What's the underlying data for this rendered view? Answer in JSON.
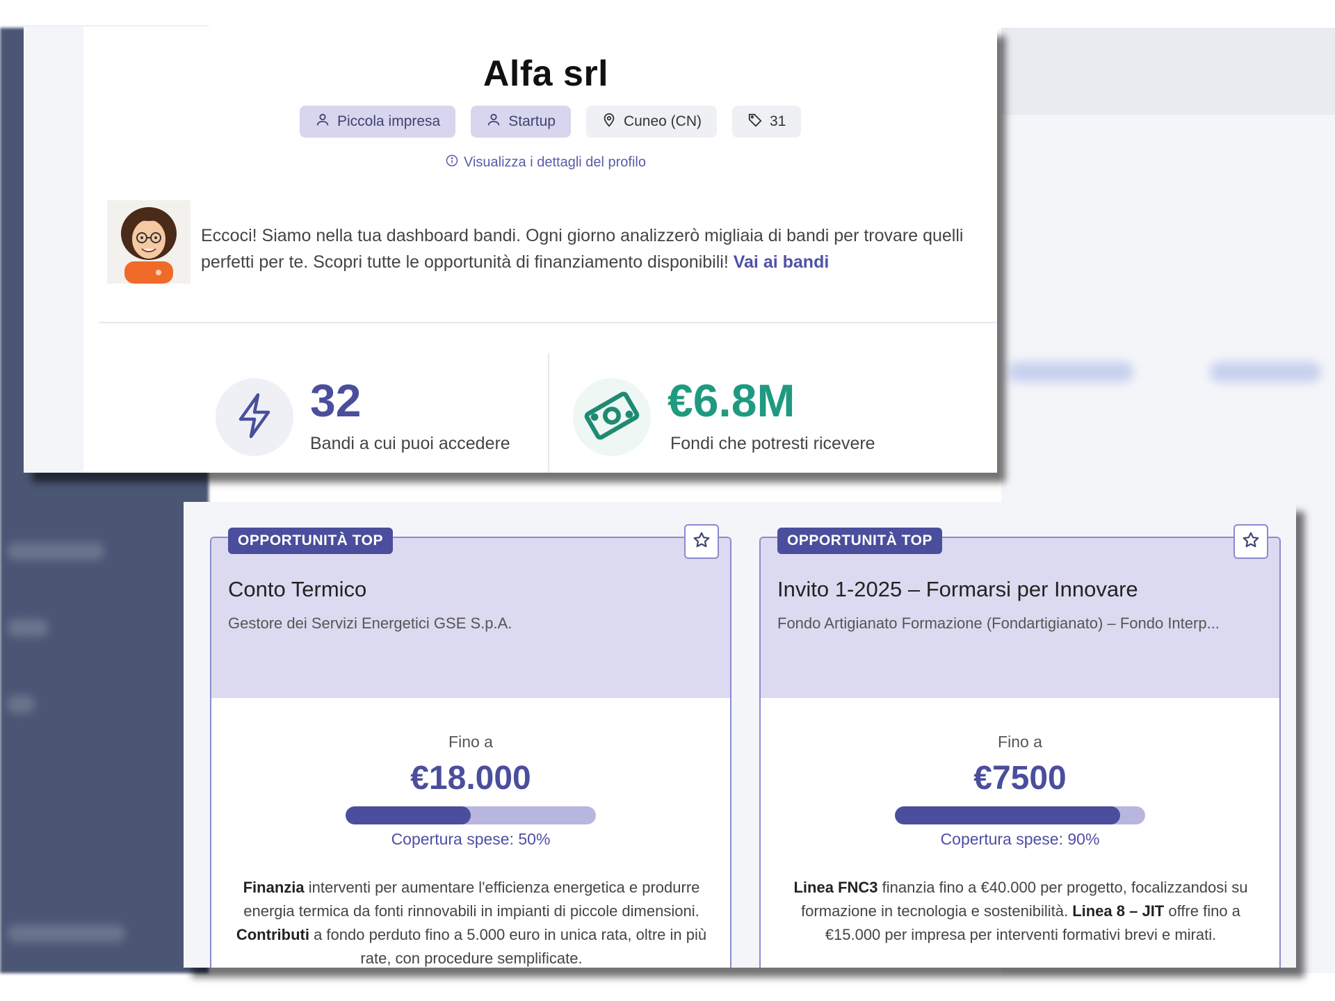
{
  "company": {
    "name": "Alfa srl",
    "tags": [
      {
        "icon": "user-icon",
        "label": "Piccola impresa"
      },
      {
        "icon": "user-icon",
        "label": "Startup"
      },
      {
        "icon": "location-pin-icon",
        "label": "Cuneo (CN)"
      },
      {
        "icon": "tag-icon",
        "label": "31"
      }
    ],
    "profile_link": "Visualizza i dettagli del profilo"
  },
  "intro": {
    "text": "Eccoci! Siamo nella tua dashboard bandi. Ogni giorno analizzerò migliaia di bandi per trovare quelli perfetti per te. Scopri tutte le opportunità di finanziamento disponibili!",
    "link": "Vai ai bandi"
  },
  "stats": [
    {
      "icon": "lightning-icon",
      "value": "32",
      "label": "Bandi a cui puoi accedere",
      "color": "#4a4e9c"
    },
    {
      "icon": "banknote-icon",
      "value": "€6.8M",
      "label": "Fondi che potresti ricevere",
      "color": "#1f9a80"
    }
  ],
  "cards": [
    {
      "badge": "OPPORTUNITÀ TOP",
      "title": "Conto Termico",
      "org": "Gestore dei Servizi Energetici GSE S.p.A.",
      "upto_label": "Fino a",
      "amount": "€18.000",
      "coverage_percent": 50,
      "coverage_label": "Copertura spese: 50%",
      "desc": [
        {
          "b": "Finanzia",
          "t": " interventi per aumentare l'efficienza energetica e produrre energia termica da fonti rinnovabili in impianti di piccole dimensioni. "
        },
        {
          "b": "Contributi",
          "t": " a fondo perduto fino a 5.000 euro in unica rata, oltre in più rate, con procedure semplificate."
        }
      ]
    },
    {
      "badge": "OPPORTUNITÀ TOP",
      "title": "Invito 1-2025 – Formarsi per Innovare",
      "org": "Fondo Artigianato Formazione (Fondartigianato) – Fondo Interp...",
      "upto_label": "Fino a",
      "amount": "€7500",
      "coverage_percent": 90,
      "coverage_label": "Copertura spese: 90%",
      "desc": [
        {
          "b": "Linea FNC3",
          "t": " finanzia fino a €40.000 per progetto, focalizzandosi su formazione in tecnologia e sostenibilità. "
        },
        {
          "b": "Linea 8 – JIT",
          "t": " offre fino a €15.000 per impresa per interventi formativi brevi e mirati."
        }
      ]
    }
  ],
  "colors": {
    "primary": "#4a4e9c",
    "teal": "#1f9a80",
    "chip_primary_bg": "#d8d6ee",
    "card_head_bg": "#dcdaf0"
  }
}
